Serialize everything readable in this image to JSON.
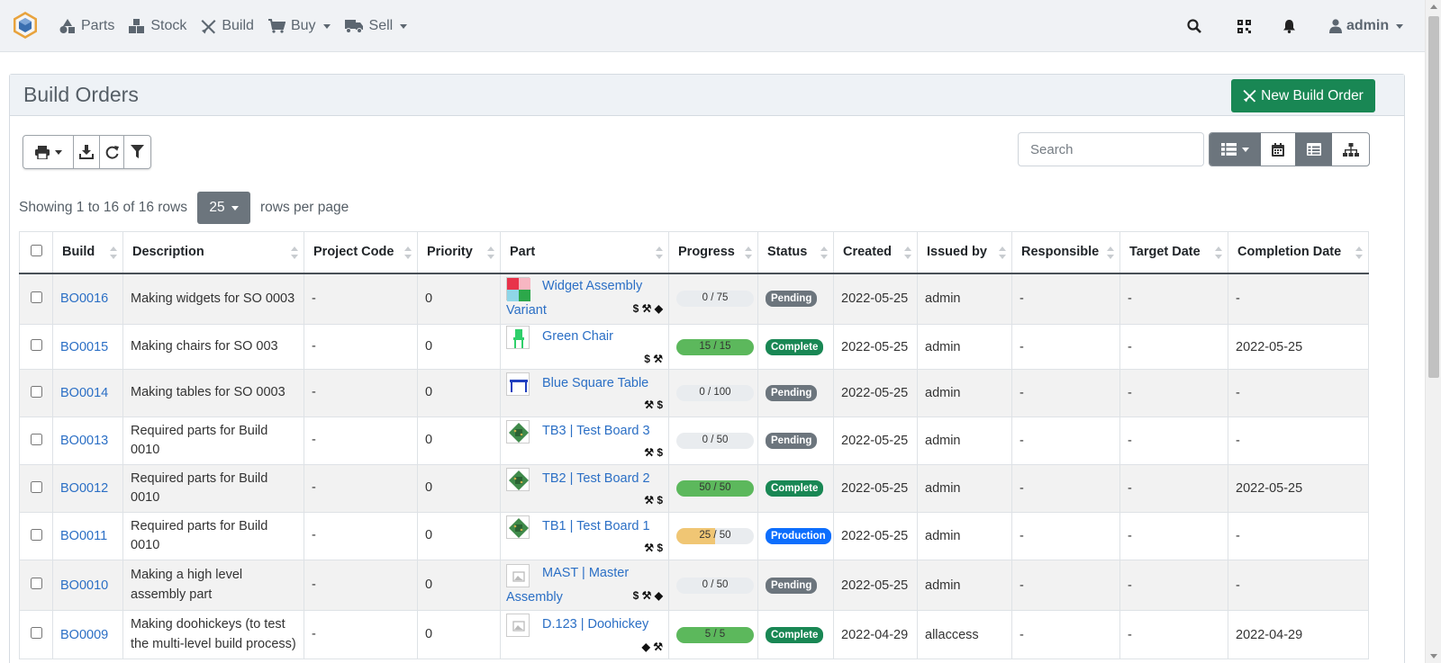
{
  "navbar": {
    "items": [
      {
        "label": "Parts",
        "icon": "shapes-icon"
      },
      {
        "label": "Stock",
        "icon": "boxes-icon"
      },
      {
        "label": "Build",
        "icon": "tools-icon"
      },
      {
        "label": "Buy",
        "icon": "shopping-cart-icon"
      },
      {
        "label": "Sell",
        "icon": "truck-icon"
      }
    ],
    "user": "admin"
  },
  "page": {
    "title": "Build Orders",
    "new_button": "New Build Order",
    "search_placeholder": "Search",
    "showing": "Showing 1 to 16 of 16 rows",
    "rows_per_page_value": "25",
    "rows_per_page_label": "rows per page"
  },
  "colors": {
    "primary_link": "#2b6fc5",
    "success": "#198754",
    "pending": "#6c757d",
    "production": "#0d6efd",
    "progress_full": "#5cb85c",
    "progress_partial": "#f0c674"
  },
  "table": {
    "headers": [
      "Build",
      "Description",
      "Project Code",
      "Priority",
      "Part",
      "Progress",
      "Status",
      "Created",
      "Issued by",
      "Responsible",
      "Target Date",
      "Completion Date"
    ],
    "rows": [
      {
        "build": "BO0016",
        "description": "Making widgets for SO 0003",
        "project_code": "-",
        "priority": "0",
        "part": "Widget Assembly Variant",
        "part_line1": "Widget Assembly",
        "part_line2": "Variant",
        "part_icons": "$ ⚒ ◆",
        "progress": "0 / 75",
        "progress_ratio": 0,
        "status": "Pending",
        "created": "2022-05-25",
        "issued_by": "admin",
        "responsible": "-",
        "target_date": "-",
        "completion_date": "-"
      },
      {
        "build": "BO0015",
        "description": "Making chairs for SO 003",
        "project_code": "-",
        "priority": "0",
        "part": "Green Chair",
        "part_line1": "Green Chair",
        "part_line2": "",
        "part_icons": "$ ⚒",
        "progress": "15 / 15",
        "progress_ratio": 1,
        "status": "Complete",
        "created": "2022-05-25",
        "issued_by": "admin",
        "responsible": "-",
        "target_date": "-",
        "completion_date": "2022-05-25"
      },
      {
        "build": "BO0014",
        "description": "Making tables for SO 0003",
        "project_code": "-",
        "priority": "0",
        "part": "Blue Square Table",
        "part_line1": "Blue Square Table",
        "part_line2": "",
        "part_icons": "⚒ $",
        "progress": "0 / 100",
        "progress_ratio": 0,
        "status": "Pending",
        "created": "2022-05-25",
        "issued_by": "admin",
        "responsible": "-",
        "target_date": "-",
        "completion_date": "-"
      },
      {
        "build": "BO0013",
        "description": "Required parts for Build 0010",
        "project_code": "-",
        "priority": "0",
        "part": "TB3 | Test Board 3",
        "part_line1": "TB3 | Test Board 3",
        "part_line2": "",
        "part_icons": "⚒ $",
        "progress": "0 / 50",
        "progress_ratio": 0,
        "status": "Pending",
        "created": "2022-05-25",
        "issued_by": "admin",
        "responsible": "-",
        "target_date": "-",
        "completion_date": "-"
      },
      {
        "build": "BO0012",
        "description": "Required parts for Build 0010",
        "project_code": "-",
        "priority": "0",
        "part": "TB2 | Test Board 2",
        "part_line1": "TB2 | Test Board 2",
        "part_line2": "",
        "part_icons": "⚒ $",
        "progress": "50 / 50",
        "progress_ratio": 1,
        "status": "Complete",
        "created": "2022-05-25",
        "issued_by": "admin",
        "responsible": "-",
        "target_date": "-",
        "completion_date": "2022-05-25"
      },
      {
        "build": "BO0011",
        "description": "Required parts for Build 0010",
        "project_code": "-",
        "priority": "0",
        "part": "TB1 | Test Board 1",
        "part_line1": "TB1 | Test Board 1",
        "part_line2": "",
        "part_icons": "⚒ $",
        "progress": "25 / 50",
        "progress_ratio": 0.5,
        "status": "Production",
        "created": "2022-05-25",
        "issued_by": "admin",
        "responsible": "-",
        "target_date": "-",
        "completion_date": "-"
      },
      {
        "build": "BO0010",
        "description": "Making a high level assembly part",
        "project_code": "-",
        "priority": "0",
        "part": "MAST | Master Assembly",
        "part_line1": "MAST | Master",
        "part_line2": "Assembly",
        "part_icons": "$ ⚒ ◆",
        "progress": "0 / 50",
        "progress_ratio": 0,
        "status": "Pending",
        "created": "2022-05-25",
        "issued_by": "admin",
        "responsible": "-",
        "target_date": "-",
        "completion_date": "-"
      },
      {
        "build": "BO0009",
        "description": "Making doohickeys (to test the multi-level build process)",
        "project_code": "-",
        "priority": "0",
        "part": "D.123 | Doohickey",
        "part_line1": "D.123 | Doohickey",
        "part_line2": "",
        "part_icons": "◆ ⚒",
        "progress": "5 / 5",
        "progress_ratio": 1,
        "status": "Complete",
        "created": "2022-04-29",
        "issued_by": "allaccess",
        "responsible": "-",
        "target_date": "-",
        "completion_date": "2022-04-29"
      }
    ]
  }
}
